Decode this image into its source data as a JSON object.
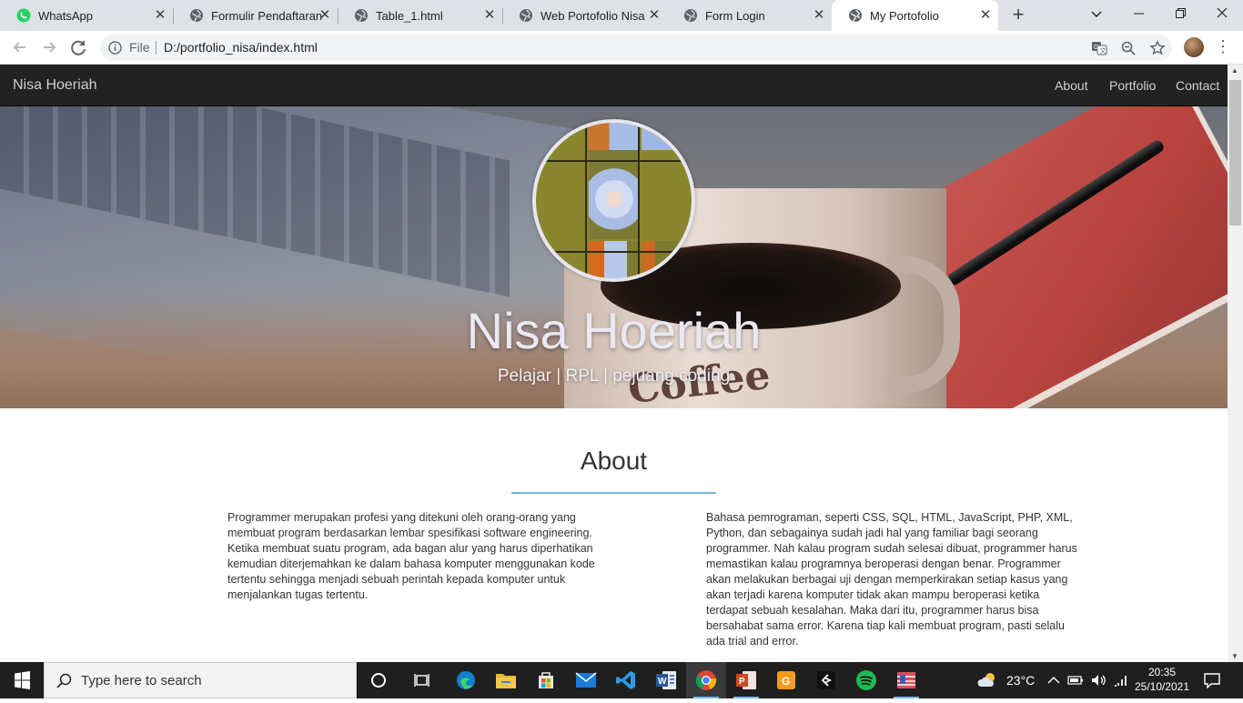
{
  "browser": {
    "tabs": [
      {
        "label": "WhatsApp",
        "icon": "whatsapp-icon"
      },
      {
        "label": "Formulir Pendaftaran",
        "icon": "globe-icon"
      },
      {
        "label": "Table_1.html",
        "icon": "globe-icon"
      },
      {
        "label": "Web Portofolio Nisa",
        "icon": "globe-icon"
      },
      {
        "label": "Form Login",
        "icon": "globe-icon"
      },
      {
        "label": "My Portofolio",
        "icon": "globe-icon",
        "active": true
      }
    ],
    "address": {
      "scheme_label": "File",
      "url": "D:/portfolio_nisa/index.html"
    }
  },
  "site": {
    "brand": "Nisa Hoeriah",
    "nav": [
      {
        "label": "About"
      },
      {
        "label": "Portfolio"
      },
      {
        "label": "Contact"
      }
    ],
    "hero": {
      "name": "Nisa Hoeriah",
      "tagline": "Pelajar | RPL | pejuang coding",
      "background_text": "Coffee"
    },
    "about": {
      "title": "About",
      "left_text": "Programmer merupakan profesi yang ditekuni oleh orang-orang yang membuat program berdasarkan lembar spesifikasi software engineering. Ketika membuat suatu program, ada bagan alur yang harus diperhatikan kemudian diterjemahkan ke dalam bahasa komputer menggunakan kode tertentu sehingga menjadi sebuah perintah kepada komputer untuk menjalankan tugas tertentu.",
      "right_text": "Bahasa pemrograman, seperti CSS, SQL, HTML, JavaScript, PHP, XML, Python, dan sebagainya sudah jadi hal yang familiar bagi seorang programmer. Nah kalau program sudah selesai dibuat, programmer harus memastikan kalau programnya beroperasi dengan benar. Programmer akan melakukan berbagai uji dengan memperkirakan setiap kasus yang akan terjadi karena komputer tidak akan mampu beroperasi ketika terdapat sebuah kesalahan. Maka dari itu, programmer harus bisa bersahabat sama error. Karena tiap kali membuat program, pasti selalu ada trial and error."
    }
  },
  "taskbar": {
    "search_placeholder": "Type here to search",
    "weather_temp": "23°C",
    "time": "20:35",
    "date": "25/10/2021"
  },
  "colors": {
    "navbar_bg": "#222222",
    "about_rule": "#76b2de",
    "tab_strip_bg": "#dee1e6"
  }
}
